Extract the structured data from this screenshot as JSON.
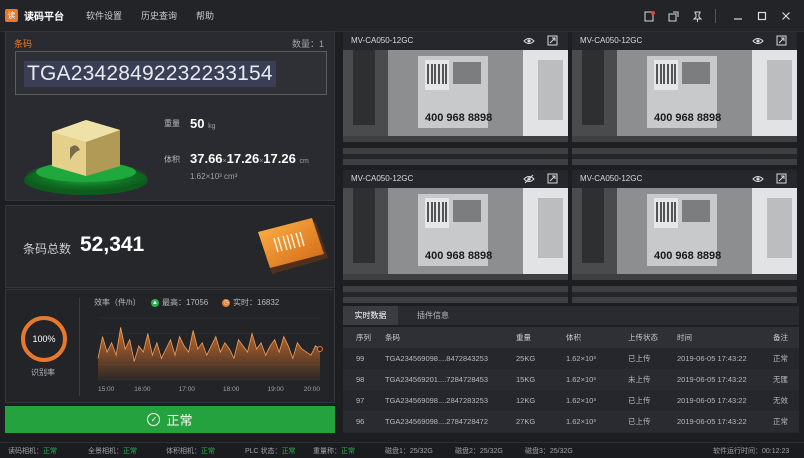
{
  "app": {
    "logo_glyph": "读",
    "title": "读码平台"
  },
  "menu": [
    "软件设置",
    "历史查询",
    "帮助"
  ],
  "barcode": {
    "label": "条码",
    "count_text": "数量：1",
    "value": "TGA23428492232233154"
  },
  "package": {
    "weight_label": "重量",
    "weight_value": "50",
    "weight_unit": "kg",
    "volume_label": "体积",
    "dim1": "37.66",
    "dim2": "17.26",
    "dim3": "17.26",
    "times": "×",
    "volume_unit": "cm",
    "volume_sub": "1.62×10³ cm³"
  },
  "totals": {
    "label": "条码总数",
    "value": "52,341"
  },
  "efficiency": {
    "ring_value": "100%",
    "ring_fraction": 1.0,
    "ring_label": "识别率",
    "title": "效率（件/h）",
    "high_text": "最高：17056",
    "current_text": "实时：16832",
    "x_ticks": [
      "15:00",
      "16:00",
      "17:00",
      "18:00",
      "19:00",
      "20:00"
    ]
  },
  "chart_data": {
    "type": "area",
    "x": [
      "15:00",
      "16:00",
      "17:00",
      "18:00",
      "19:00",
      "20:00"
    ],
    "series": [
      {
        "values": [
          35,
          70,
          45,
          60,
          40,
          85,
          50,
          65,
          30,
          55,
          45,
          75,
          40,
          60,
          35,
          50,
          65,
          40,
          70,
          55,
          45,
          80,
          50,
          60,
          40,
          55,
          70,
          45,
          60,
          50,
          35,
          65,
          55,
          45,
          75,
          50,
          60,
          40,
          55,
          65,
          45,
          70,
          55,
          35,
          60,
          50,
          45,
          40,
          55,
          50
        ]
      }
    ]
  },
  "status_button": {
    "label": "正常",
    "color": "#24a23e"
  },
  "cameras": [
    {
      "name": "MV-CA050-12GC",
      "view_icon": "eye-icon"
    },
    {
      "name": "MV-CA050-12GC",
      "view_icon": "eye-icon"
    },
    {
      "name": "MV-CA050-12GC",
      "view_icon": "eye-off-icon"
    },
    {
      "name": "MV-CA050-12GC",
      "view_icon": "eye-icon"
    }
  ],
  "camera_box_text": "400 968 8898",
  "tabs": [
    "实时数据",
    "插件信息"
  ],
  "table": {
    "headers": [
      "序列",
      "条码",
      "重量",
      "体积",
      "上传状态",
      "时间",
      "备注"
    ],
    "rows": [
      [
        "99",
        "TGA234569098....8472843253",
        "25KG",
        "1.62×10³",
        "已上传",
        "2019-06-05 17:43:22",
        "正常"
      ],
      [
        "98",
        "TGA234569201....7284728453",
        "15KG",
        "1.62×10³",
        "未上传",
        "2019-06-05 17:43:22",
        "无匯"
      ],
      [
        "97",
        "TGA234569098....2847283253",
        "12KG",
        "1.62×10³",
        "已上传",
        "2019-06-05 17:43:22",
        "无效"
      ],
      [
        "96",
        "TGA234569098....2784728472",
        "27KG",
        "1.62×10³",
        "已上传",
        "2019-06-05 17:43:22",
        "正常"
      ]
    ]
  },
  "statusbar": {
    "reader": {
      "label": "读码相机：",
      "value": "正常"
    },
    "full": {
      "label": "全景相机：",
      "value": "正常"
    },
    "volume": {
      "label": "体积相机：",
      "value": "正常"
    },
    "plc": {
      "label": "PLC 状态：",
      "value": "正常"
    },
    "scale": {
      "label": "重量称：",
      "value": "正常"
    },
    "disk1": "磁盘1：25/32G",
    "disk2": "磁盘2：25/32G",
    "disk3": "磁盘3：25/32G",
    "runtime_label": "软件运行时间：",
    "runtime_value": "00:12:23"
  },
  "colors": {
    "accent": "#e8782a",
    "ok": "#2bb24c",
    "high_dot": "#2bb24c",
    "current_dot": "#e8782a"
  }
}
